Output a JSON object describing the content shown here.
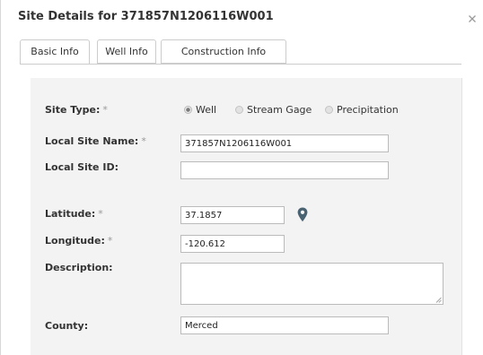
{
  "dialog": {
    "title": "Site Details for 371857N1206116W001"
  },
  "tabs": [
    {
      "label": "Basic Info"
    },
    {
      "label": "Well Info"
    },
    {
      "label": "Construction Info"
    }
  ],
  "form": {
    "site_type": {
      "label": "Site Type:",
      "required_mark": "*",
      "options": [
        "Well",
        "Stream Gage",
        "Precipitation"
      ],
      "selected": "Well"
    },
    "local_site_name": {
      "label": "Local Site Name:",
      "required_mark": "*",
      "value": "371857N1206116W001"
    },
    "local_site_id": {
      "label": "Local Site ID:",
      "value": ""
    },
    "latitude": {
      "label": "Latitude:",
      "required_mark": "*",
      "value": "37.1857"
    },
    "longitude": {
      "label": "Longitude:",
      "required_mark": "*",
      "value": "-120.612"
    },
    "description": {
      "label": "Description:",
      "value": ""
    },
    "county": {
      "label": "County:",
      "value": "Merced"
    }
  },
  "icons": {
    "close": "close-icon",
    "map_pin": "map-pin-icon",
    "resize": "resize-grip-icon"
  },
  "colors": {
    "panel_bg": "#f3f3f3",
    "pin": "#4a6373",
    "text": "#333333"
  }
}
